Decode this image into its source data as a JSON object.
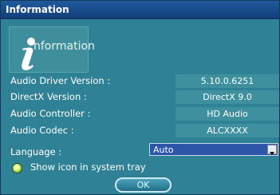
{
  "window": {
    "title": "Information"
  },
  "logo": {
    "letter": "i",
    "text": "nformation"
  },
  "rows": [
    {
      "label": "Audio Driver Version :",
      "value": "5.10.0.6251"
    },
    {
      "label": "DirectX Version :",
      "value": "DirectX 9.0"
    },
    {
      "label": "Audio Controller :",
      "value": "HD Audio"
    },
    {
      "label": "Audio Codec :",
      "value": "ALCXXXX"
    }
  ],
  "language": {
    "label": "Language :",
    "value": "Auto"
  },
  "tray": {
    "label": "Show icon in system tray"
  },
  "buttons": {
    "ok_label": "OK"
  },
  "colors": {
    "background": "#2f8296",
    "titlebar": "#1f5a9c",
    "select_background": "#2d55a8",
    "value_field": "#3f909f"
  },
  "icons": [
    "information-logo-icon",
    "dropdown-arrow-icon",
    "radio-button-icon"
  ]
}
